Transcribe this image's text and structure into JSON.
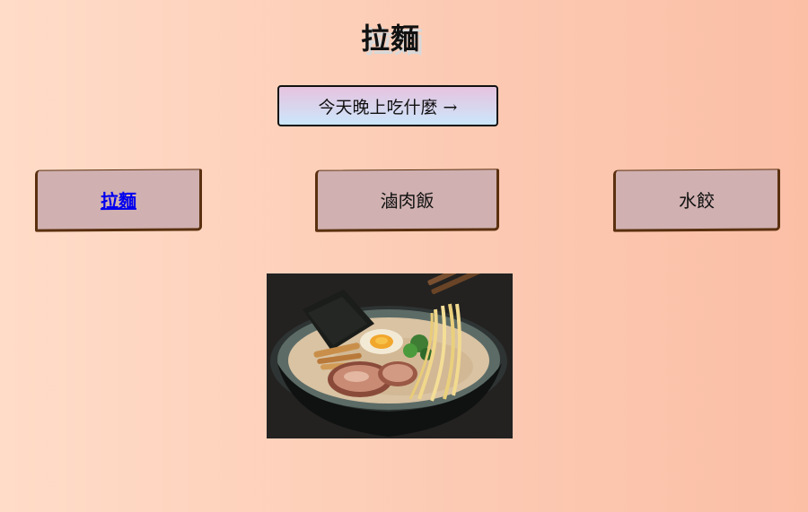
{
  "page": {
    "title": "拉麵"
  },
  "nav": {
    "next_label": "今天晚上吃什麼 →"
  },
  "tabs": [
    {
      "label": "拉麵",
      "active": true
    },
    {
      "label": "滷肉飯",
      "active": false
    },
    {
      "label": "水餃",
      "active": false
    }
  ],
  "image": {
    "subject": "ramen-bowl-photo"
  },
  "colors": {
    "tab_bg": "#d0b0b0",
    "tab_border": "#5a300f",
    "active_link": "#0000ee"
  }
}
